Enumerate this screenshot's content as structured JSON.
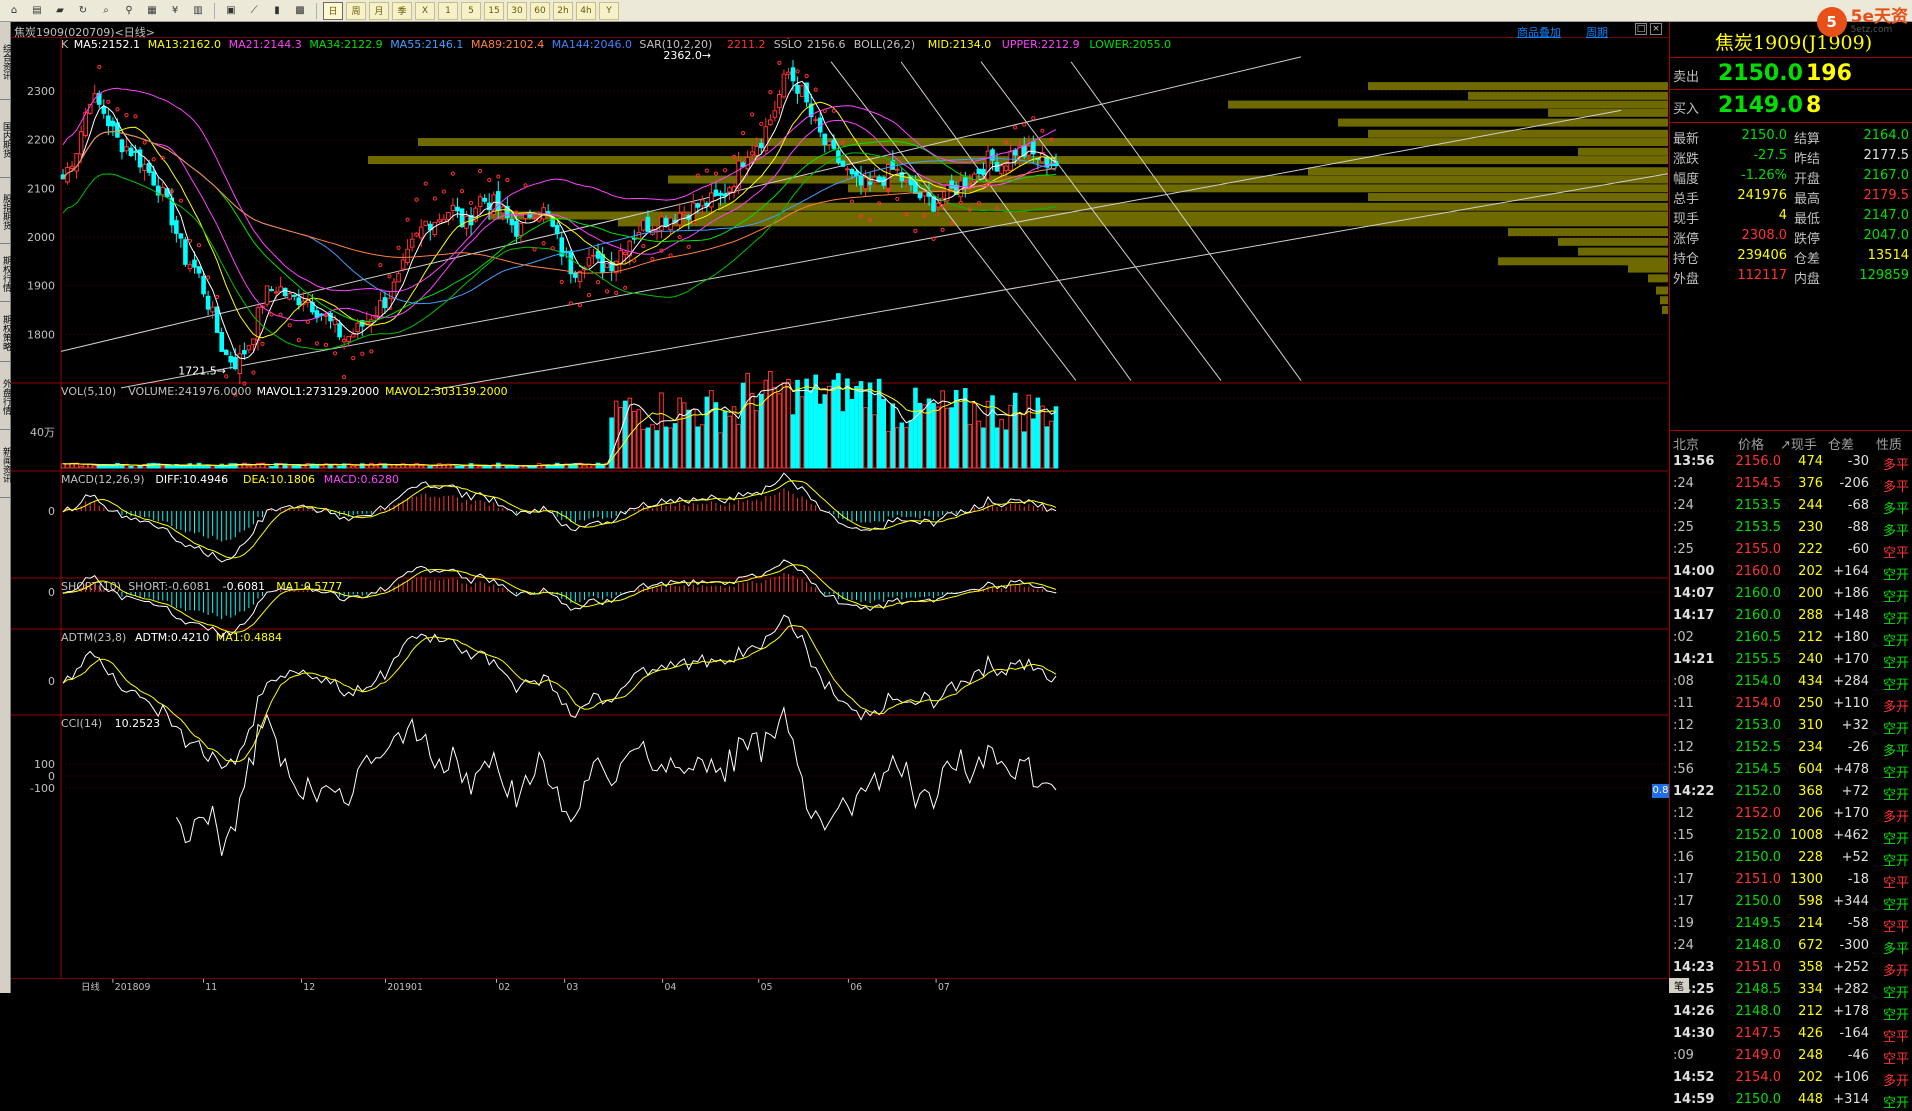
{
  "toolbar": {
    "icons": [
      "home-icon",
      "book-icon",
      "folder-icon",
      "refresh-icon",
      "search-icon",
      "zoom-icon",
      "gallery-icon",
      "pay-icon",
      "chart-icon",
      "window-icon",
      "line-chart-icon",
      "candle-icon",
      "grid-icon"
    ],
    "candle_label": "K",
    "periods": [
      "日",
      "周",
      "月",
      "季",
      "X",
      "1",
      "5",
      "15",
      "30",
      "60",
      "2h",
      "4h",
      "Y"
    ],
    "active_period": 0
  },
  "logo": {
    "mark": "5",
    "name": "5e天资",
    "url_text": "5etz.com"
  },
  "left_tabs": [
    "综合资讯",
    "国内期货",
    "股指期货",
    "期权行情",
    "期权策略",
    "外盘行情",
    "新闻资讯"
  ],
  "chart": {
    "title": "焦炭1909(020709)<日线>",
    "links": {
      "overlay": "商品叠加",
      "period": "周期"
    },
    "price_indicators": [
      {
        "text": "K",
        "color": "#c0c0c0"
      },
      {
        "text": "MA5:2152.1",
        "color": "#ffffff"
      },
      {
        "text": "MA13:2162.0",
        "color": "#ffff00"
      },
      {
        "text": "MA21:2144.3",
        "color": "#ff40ff"
      },
      {
        "text": "MA34:2122.9",
        "color": "#00e000"
      },
      {
        "text": "MA55:2146.1",
        "color": "#40a0ff"
      },
      {
        "text": "MA89:2102.4",
        "color": "#ff8040"
      },
      {
        "text": "MA144:2046.0",
        "color": "#4080ff"
      },
      {
        "text": "SAR(10,2,20)",
        "color": "#c0c0c0"
      },
      {
        "text": "2211.2",
        "color": "#ff3232"
      },
      {
        "text": "SSLO",
        "color": "#c0c0c0"
      },
      {
        "text": "2156.6",
        "color": "#c0c0c0"
      },
      {
        "text": "BOLL(26,2)",
        "color": "#c0c0c0"
      },
      {
        "text": "MID:2134.0",
        "color": "#ffff00"
      },
      {
        "text": "UPPER:2212.9",
        "color": "#ff40ff"
      },
      {
        "text": "LOWER:2055.0",
        "color": "#00e000"
      }
    ],
    "price_ticks": [
      "2300",
      "2200",
      "2100",
      "2000",
      "1900",
      "1800"
    ],
    "high_label": "2362.0→",
    "low_label": "1721.5→",
    "vol_header": [
      {
        "text": "VOL(5,10)",
        "color": "#c0c0c0"
      },
      {
        "text": "VOLUME:241976.0000",
        "color": "#c0c0c0"
      },
      {
        "text": "MAVOL1:273129.2000",
        "color": "#ffffff"
      },
      {
        "text": "MAVOL2:303139.2000",
        "color": "#ffff00"
      }
    ],
    "vol_tick": "40万",
    "macd_header": [
      {
        "text": "MACD(12,26,9)",
        "color": "#c0c0c0"
      },
      {
        "text": "DIFF:10.4946",
        "color": "#ffffff"
      },
      {
        "text": "DEA:10.1806",
        "color": "#ffff00"
      },
      {
        "text": "MACD:0.6280",
        "color": "#ff40ff"
      }
    ],
    "macd_tick": "0",
    "short_header": [
      {
        "text": "SHORT(10)",
        "color": "#c0c0c0"
      },
      {
        "text": "SHORT:-0.6081",
        "color": "#c0c0c0"
      },
      {
        "text": "-0.6081",
        "color": "#ffffff"
      },
      {
        "text": "MA1:0.5777",
        "color": "#ffff00"
      }
    ],
    "short_tick": "0",
    "adtm_header": [
      {
        "text": "ADTM(23,8)",
        "color": "#c0c0c0"
      },
      {
        "text": "ADTM:0.4210",
        "color": "#ffffff"
      },
      {
        "text": "MA1:0.4884",
        "color": "#ffff00"
      }
    ],
    "adtm_tick": "0",
    "adtm_badge": "0.8",
    "cci_header": [
      {
        "text": "CCI(14)",
        "color": "#c0c0c0"
      },
      {
        "text": "10.2523",
        "color": "#ffffff"
      }
    ],
    "cci_ticks": [
      "100",
      "0",
      "-100"
    ],
    "x_labels": [
      "日线",
      "201809",
      "11",
      "12",
      "201901",
      "02",
      "03",
      "04",
      "05",
      "06",
      "07"
    ]
  },
  "chart_data": {
    "type": "candlestick",
    "title": "焦炭1909(020709)<日线>",
    "price_range": [
      1700,
      2380
    ],
    "price_ticks": [
      1800,
      1900,
      2000,
      2100,
      2200,
      2300
    ],
    "period_start": "2018-09",
    "period_end": "2019-07",
    "high": 2362.0,
    "low": 1721.5,
    "last_indicators": {
      "MA5": 2152.1,
      "MA13": 2162.0,
      "MA21": 2144.3,
      "MA34": 2122.9,
      "MA55": 2146.1,
      "MA89": 2102.4,
      "MA144": 2046.0,
      "SAR": 2211.2,
      "SSLO": 2156.6,
      "BOLL_MID": 2134.0,
      "BOLL_UPPER": 2212.9,
      "BOLL_LOWER": 2055.0
    },
    "approx_close_path": [
      2120,
      2180,
      2290,
      2260,
      2200,
      2180,
      2150,
      2110,
      2050,
      1960,
      1930,
      1850,
      1760,
      1740,
      1790,
      1880,
      1900,
      1870,
      1880,
      1850,
      1820,
      1790,
      1810,
      1840,
      1870,
      1910,
      1980,
      2030,
      2040,
      2060,
      2020,
      2080,
      2070,
      2040,
      2010,
      2060,
      2050,
      1980,
      1930,
      1960,
      1940,
      1950,
      1990,
      2020,
      2030,
      2040,
      2050,
      2060,
      2070,
      2080,
      2120,
      2180,
      2200,
      2260,
      2340,
      2300,
      2230,
      2180,
      2150,
      2110,
      2100,
      2120,
      2140,
      2100,
      2080,
      2070,
      2090,
      2110,
      2130,
      2160,
      2150,
      2180,
      2170,
      2160,
      2150
    ],
    "volume": {
      "last": 241976,
      "MAVOL1": 273129.2,
      "MAVOL2": 303139.2,
      "tick": "40万"
    },
    "MACD": {
      "DIFF": 10.4946,
      "DEA": 10.1806,
      "MACD": 0.628
    },
    "SHORT": {
      "SHORT": -0.6081,
      "MA1": 0.5777
    },
    "ADTM": {
      "ADTM": 0.421,
      "MA1": 0.4884
    },
    "CCI": {
      "CCI": 10.2523
    }
  },
  "quote": {
    "title": "焦炭1909(J1909)",
    "sell": {
      "label": "卖出",
      "price": "2150.0",
      "qty": "196"
    },
    "buy": {
      "label": "买入",
      "price": "2149.0",
      "qty": "8"
    },
    "stats": [
      {
        "l1": "最新",
        "v1": "2150.0",
        "c1": "green",
        "l2": "结算",
        "v2": "2164.0",
        "c2": "green"
      },
      {
        "l1": "涨跌",
        "v1": "-27.5",
        "c1": "green",
        "l2": "昨结",
        "v2": "2177.5",
        "c2": "white"
      },
      {
        "l1": "幅度",
        "v1": "-1.26%",
        "c1": "green",
        "l2": "开盘",
        "v2": "2167.0",
        "c2": "green"
      },
      {
        "l1": "总手",
        "v1": "241976",
        "c1": "yellow",
        "l2": "最高",
        "v2": "2179.5",
        "c2": "red"
      },
      {
        "l1": "现手",
        "v1": "4",
        "c1": "yellow",
        "l2": "最低",
        "v2": "2147.0",
        "c2": "green"
      },
      {
        "l1": "涨停",
        "v1": "2308.0",
        "c1": "red",
        "l2": "跌停",
        "v2": "2047.0",
        "c2": "green"
      },
      {
        "l1": "持仓",
        "v1": "239406",
        "c1": "yellow",
        "l2": "仓差",
        "v2": "13514",
        "c2": "yellow"
      },
      {
        "l1": "外盘",
        "v1": "112117",
        "c1": "red",
        "l2": "内盘",
        "v2": "129859",
        "c2": "green"
      }
    ],
    "tick_header": {
      "time": "北京",
      "price": "价格",
      "vol": "↗现手",
      "oi": "仓差",
      "nature": "性质"
    },
    "ticks": [
      {
        "t": "13:56",
        "full": true,
        "p": "2156.0",
        "pc": "red",
        "v": "474",
        "oi": "-30",
        "n": "多平",
        "nc": "red"
      },
      {
        "t": ":24",
        "full": false,
        "p": "2154.5",
        "pc": "red",
        "v": "376",
        "oi": "-206",
        "n": "多平",
        "nc": "red"
      },
      {
        "t": ":24",
        "full": false,
        "p": "2153.5",
        "pc": "green",
        "v": "244",
        "oi": "-68",
        "n": "多平",
        "nc": "green"
      },
      {
        "t": ":25",
        "full": false,
        "p": "2153.5",
        "pc": "green",
        "v": "230",
        "oi": "-88",
        "n": "多平",
        "nc": "green"
      },
      {
        "t": ":25",
        "full": false,
        "p": "2155.0",
        "pc": "red",
        "v": "222",
        "oi": "-60",
        "n": "空平",
        "nc": "red"
      },
      {
        "t": "14:00",
        "full": true,
        "p": "2160.0",
        "pc": "red",
        "v": "202",
        "oi": "+164",
        "n": "空开",
        "nc": "green"
      },
      {
        "t": "14:07",
        "full": true,
        "p": "2160.0",
        "pc": "green",
        "v": "200",
        "oi": "+186",
        "n": "空开",
        "nc": "green"
      },
      {
        "t": "14:17",
        "full": true,
        "p": "2160.0",
        "pc": "green",
        "v": "288",
        "oi": "+148",
        "n": "空开",
        "nc": "green"
      },
      {
        "t": ":02",
        "full": false,
        "p": "2160.5",
        "pc": "green",
        "v": "212",
        "oi": "+180",
        "n": "空开",
        "nc": "green"
      },
      {
        "t": "14:21",
        "full": true,
        "p": "2155.5",
        "pc": "green",
        "v": "240",
        "oi": "+170",
        "n": "空开",
        "nc": "green"
      },
      {
        "t": ":08",
        "full": false,
        "p": "2154.0",
        "pc": "green",
        "v": "434",
        "oi": "+284",
        "n": "空开",
        "nc": "green"
      },
      {
        "t": ":11",
        "full": false,
        "p": "2154.0",
        "pc": "red",
        "v": "250",
        "oi": "+110",
        "n": "多开",
        "nc": "red"
      },
      {
        "t": ":12",
        "full": false,
        "p": "2153.0",
        "pc": "green",
        "v": "310",
        "oi": "+32",
        "n": "空开",
        "nc": "green"
      },
      {
        "t": ":12",
        "full": false,
        "p": "2152.5",
        "pc": "green",
        "v": "234",
        "oi": "-26",
        "n": "多平",
        "nc": "green"
      },
      {
        "t": ":56",
        "full": false,
        "p": "2154.5",
        "pc": "green",
        "v": "604",
        "oi": "+478",
        "n": "空开",
        "nc": "green"
      },
      {
        "t": "14:22",
        "full": true,
        "p": "2152.0",
        "pc": "green",
        "v": "368",
        "oi": "+72",
        "n": "空开",
        "nc": "green"
      },
      {
        "t": ":12",
        "full": false,
        "p": "2152.0",
        "pc": "red",
        "v": "206",
        "oi": "+170",
        "n": "多开",
        "nc": "red"
      },
      {
        "t": ":15",
        "full": false,
        "p": "2152.0",
        "pc": "green",
        "v": "1008",
        "oi": "+462",
        "n": "空开",
        "nc": "green"
      },
      {
        "t": ":16",
        "full": false,
        "p": "2150.0",
        "pc": "green",
        "v": "228",
        "oi": "+52",
        "n": "空开",
        "nc": "green"
      },
      {
        "t": ":17",
        "full": false,
        "p": "2151.0",
        "pc": "red",
        "v": "1300",
        "oi": "-18",
        "n": "空平",
        "nc": "red"
      },
      {
        "t": ":17",
        "full": false,
        "p": "2150.0",
        "pc": "green",
        "v": "598",
        "oi": "+344",
        "n": "空开",
        "nc": "green"
      },
      {
        "t": ":19",
        "full": false,
        "p": "2149.5",
        "pc": "green",
        "v": "214",
        "oi": "-58",
        "n": "空平",
        "nc": "red"
      },
      {
        "t": ":24",
        "full": false,
        "p": "2148.0",
        "pc": "green",
        "v": "672",
        "oi": "-300",
        "n": "多平",
        "nc": "green"
      },
      {
        "t": "14:23",
        "full": true,
        "p": "2151.0",
        "pc": "red",
        "v": "358",
        "oi": "+252",
        "n": "多开",
        "nc": "red"
      },
      {
        "t": "14:25",
        "full": true,
        "p": "2148.5",
        "pc": "green",
        "v": "334",
        "oi": "+282",
        "n": "空开",
        "nc": "green"
      },
      {
        "t": "14:26",
        "full": true,
        "p": "2148.0",
        "pc": "green",
        "v": "212",
        "oi": "+178",
        "n": "空开",
        "nc": "green"
      },
      {
        "t": "14:30",
        "full": true,
        "p": "2147.5",
        "pc": "red",
        "v": "426",
        "oi": "-164",
        "n": "空平",
        "nc": "red"
      },
      {
        "t": ":09",
        "full": false,
        "p": "2149.0",
        "pc": "red",
        "v": "248",
        "oi": "-46",
        "n": "空平",
        "nc": "red"
      },
      {
        "t": "14:52",
        "full": true,
        "p": "2154.0",
        "pc": "red",
        "v": "202",
        "oi": "+106",
        "n": "多开",
        "nc": "red"
      },
      {
        "t": "14:59",
        "full": true,
        "p": "2150.0",
        "pc": "green",
        "v": "448",
        "oi": "+314",
        "n": "空开",
        "nc": "green"
      }
    ],
    "corner_label": "笔"
  }
}
